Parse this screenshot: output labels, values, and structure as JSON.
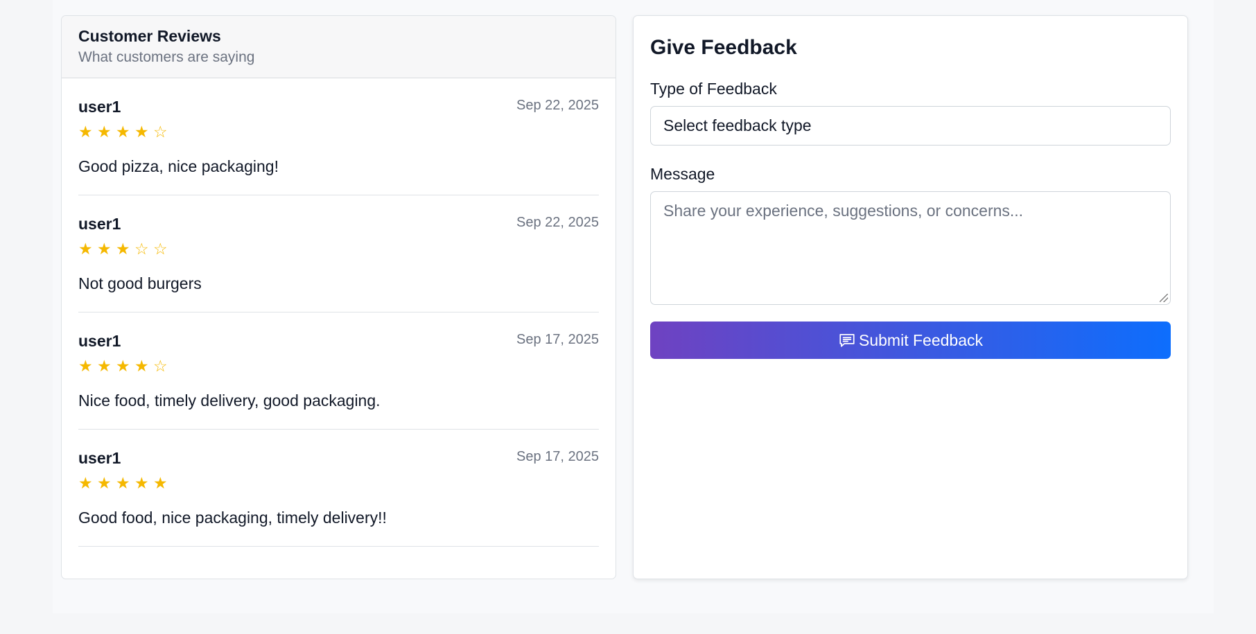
{
  "reviews": {
    "title": "Customer Reviews",
    "subtitle": "What customers are saying",
    "items": [
      {
        "user": "user1",
        "date": "Sep 22, 2025",
        "stars": [
          "★",
          "★",
          "★",
          "★",
          "☆"
        ],
        "rating": 4,
        "text": "Good pizza, nice packaging!"
      },
      {
        "user": "user1",
        "date": "Sep 22, 2025",
        "stars": [
          "★",
          "★",
          "★",
          "☆",
          "☆"
        ],
        "rating": 3,
        "text": "Not good burgers"
      },
      {
        "user": "user1",
        "date": "Sep 17, 2025",
        "stars": [
          "★",
          "★",
          "★",
          "★",
          "☆"
        ],
        "rating": 4,
        "text": "Nice food, timely delivery, good packaging."
      },
      {
        "user": "user1",
        "date": "Sep 17, 2025",
        "stars": [
          "★",
          "★",
          "★",
          "★",
          "★"
        ],
        "rating": 5,
        "text": "Good food, nice packaging, timely delivery!!"
      }
    ]
  },
  "feedback": {
    "title": "Give Feedback",
    "type_label": "Type of Feedback",
    "type_value": "Select feedback type",
    "message_label": "Message",
    "message_placeholder": "Share your experience, suggestions, or concerns...",
    "submit_label": "Submit Feedback",
    "submit_icon": "message-square-icon"
  },
  "colors": {
    "star": "#f5b800",
    "button_gradient_start": "#6f42c1",
    "button_gradient_end": "#0d6efd"
  }
}
